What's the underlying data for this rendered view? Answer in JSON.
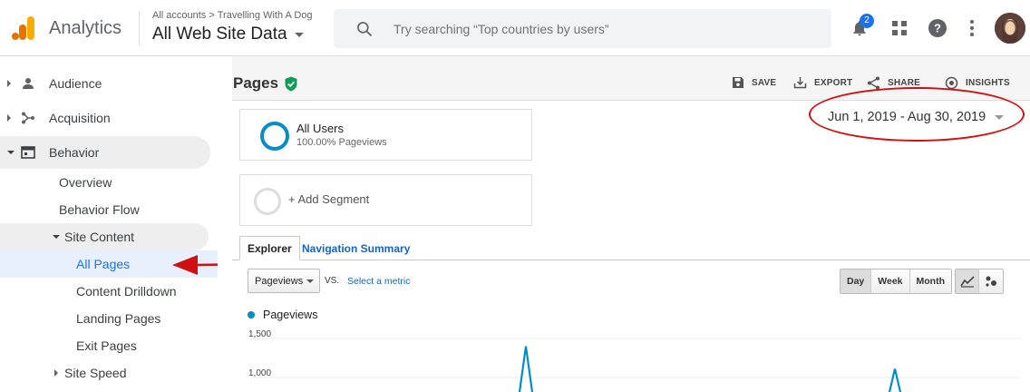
{
  "header": {
    "app_title": "Analytics",
    "breadcrumb": [
      "All accounts",
      "Travelling With A Dog"
    ],
    "breadcrumb_sep": ">",
    "view_name": "All Web Site Data",
    "search_placeholder": "Try searching “Top countries by users”",
    "notification_count": "2",
    "icons": [
      "analytics-logo-icon",
      "search-icon",
      "bell-icon",
      "apps-grid-icon",
      "help-icon",
      "more-vert-icon",
      "avatar"
    ]
  },
  "sidebar": {
    "items": [
      {
        "label": "Audience",
        "icon": "person-icon"
      },
      {
        "label": "Acquisition",
        "icon": "acquisition-icon"
      },
      {
        "label": "Behavior",
        "icon": "behavior-icon"
      }
    ],
    "behavior_sub": [
      "Overview",
      "Behavior Flow"
    ],
    "site_content": {
      "label": "Site Content",
      "children": [
        "All Pages",
        "Content Drilldown",
        "Landing Pages",
        "Exit Pages"
      ]
    },
    "site_speed": "Site Speed"
  },
  "report": {
    "title": "Pages",
    "actions": [
      "SAVE",
      "EXPORT",
      "SHARE",
      "INSIGHTS"
    ],
    "segments": {
      "all_users": "All Users",
      "all_users_sub": "100.00% Pageviews",
      "add_segment": "+ Add Segment"
    },
    "date_range": "Jun 1, 2019 - Aug 30, 2019",
    "tabs": [
      "Explorer",
      "Navigation Summary"
    ],
    "metric": "Pageviews",
    "vs": "VS.",
    "select_metric": "Select a metric",
    "granularity": [
      "Day",
      "Week",
      "Month"
    ],
    "active_granularity": "Day"
  },
  "chart_data": {
    "type": "line",
    "series": [
      {
        "name": "Pageviews",
        "values": [
          1400,
          1110
        ]
      }
    ],
    "yticks": [
      "1,500",
      "1,000"
    ],
    "ylim": [
      0,
      1500
    ],
    "color": "#058dc7"
  },
  "colors": {
    "accent": "#1a73e8",
    "annotation_red": "#d01010",
    "series_blue": "#058dc7"
  }
}
